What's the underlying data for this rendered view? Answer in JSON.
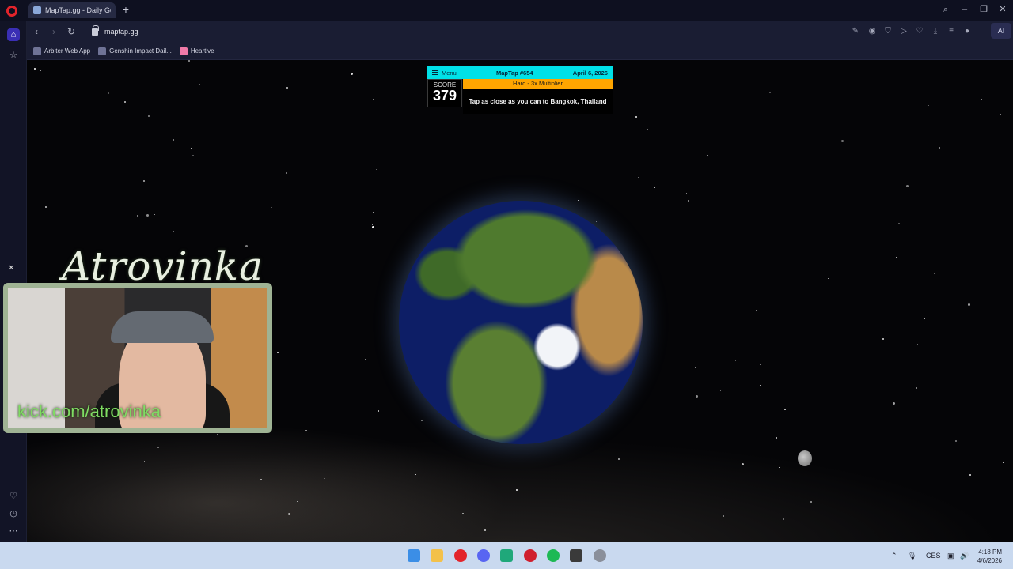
{
  "browser": {
    "tab_title": "MapTap.gg - Daily Geogra",
    "url": "maptap.gg",
    "ai_label": "AI",
    "bookmarks": [
      {
        "label": "Arbiter Web App"
      },
      {
        "label": "Genshin Impact Dail..."
      },
      {
        "label": "Heartive"
      }
    ]
  },
  "maptap": {
    "menu_label": "Menu",
    "game_id": "MapTap #654",
    "date": "April 6, 2026",
    "score_label": "SCORE",
    "score_value": "379",
    "multiplier": "Hard - 3x Multiplier",
    "prompt": "Tap as close as you can to Bangkok, Thailand"
  },
  "overlay": {
    "streamer_name": "Atrovinka",
    "channel_link": "kick.com/atrovinka"
  },
  "taskbar": {
    "language": "CES",
    "time": "4:18 PM",
    "date": "4/6/2026"
  },
  "colors": {
    "maptap_accent": "#00e1e7",
    "multiplier_bg": "#ffa500",
    "active_sidebar": "#3a2fb5"
  }
}
